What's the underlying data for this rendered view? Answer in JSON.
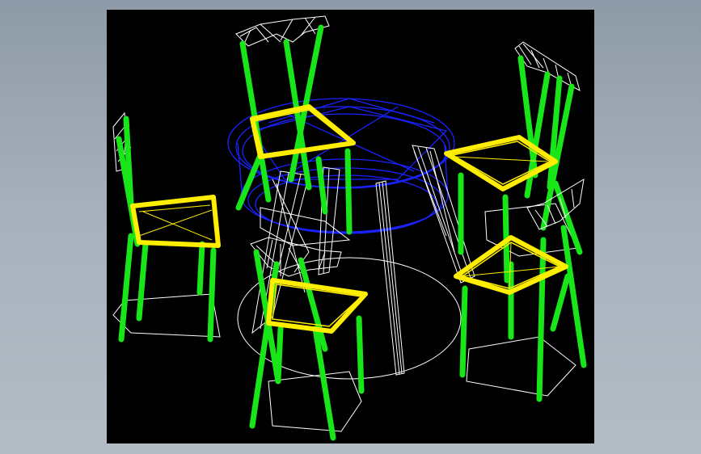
{
  "scene": {
    "description_free": true,
    "colors": {
      "window_background": "#a6b0bb",
      "viewport_background": "#000000",
      "table_top": "#1a22ff",
      "seat_frame": "#ffee00",
      "legs": "#19e619",
      "wireframe": "#ffffff"
    },
    "objects": [
      {
        "kind": "round-table"
      },
      {
        "kind": "chair"
      },
      {
        "kind": "chair"
      },
      {
        "kind": "chair"
      },
      {
        "kind": "chair"
      },
      {
        "kind": "chair"
      }
    ]
  }
}
